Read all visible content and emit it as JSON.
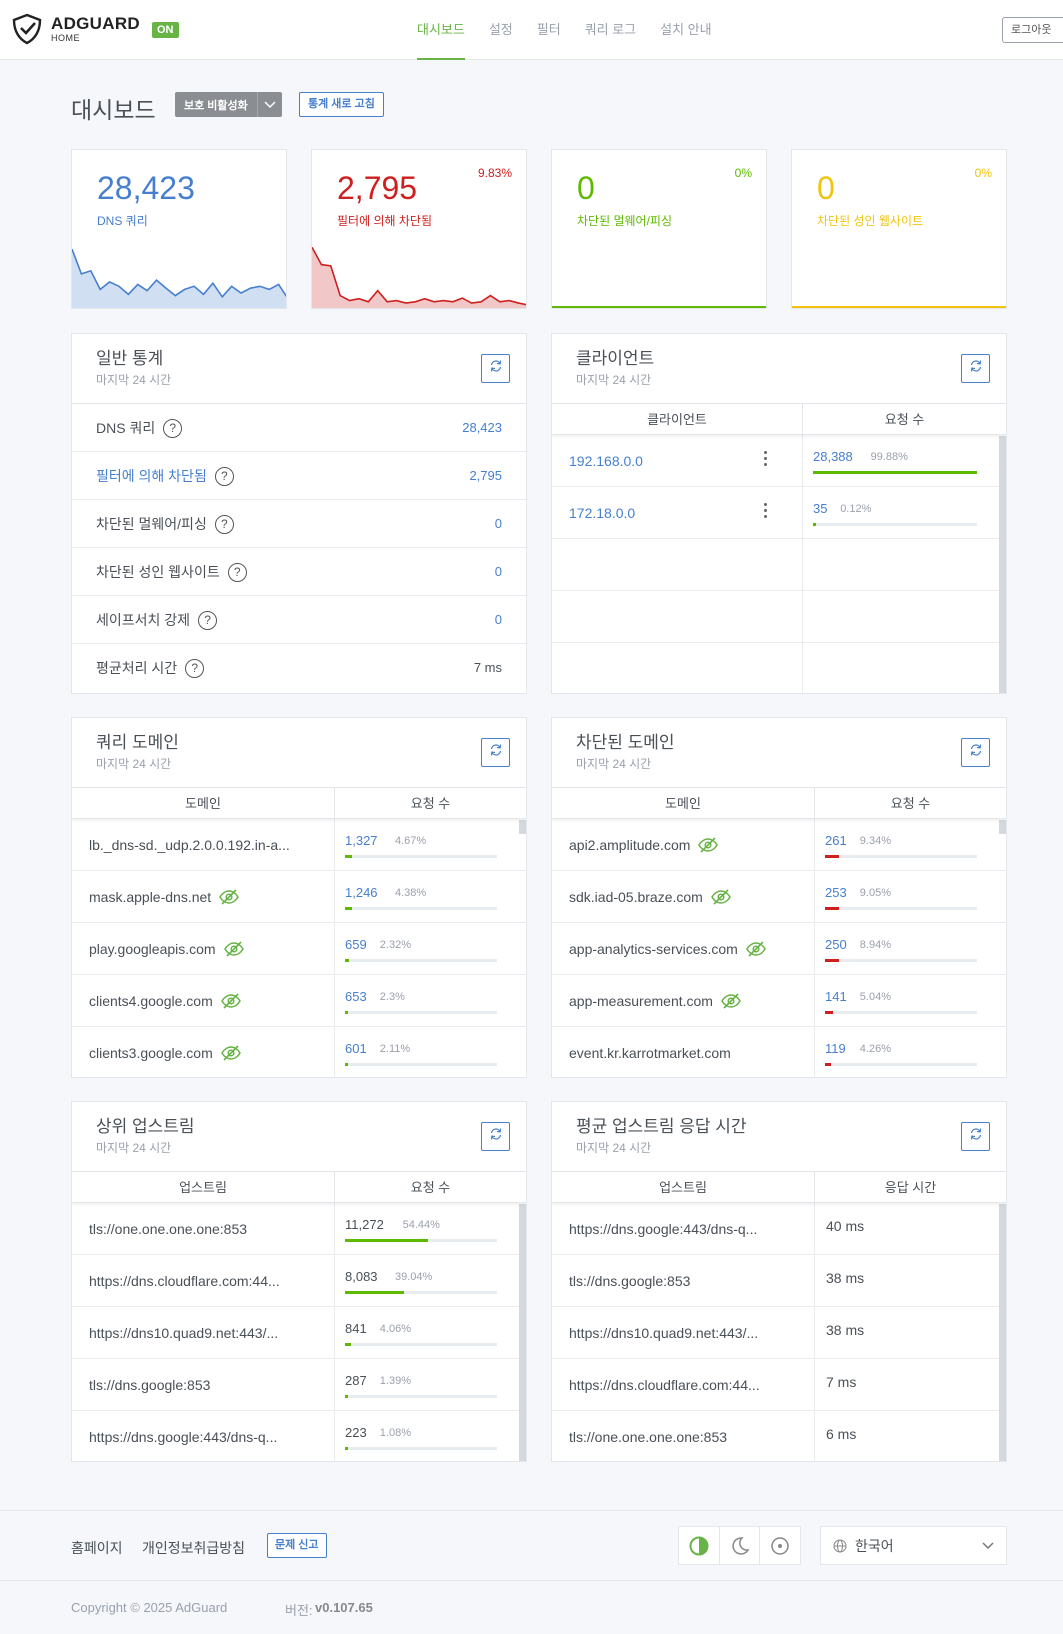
{
  "header": {
    "logo_title": "ADGUARD",
    "logo_sub": "HOME",
    "status_badge": "ON",
    "nav": [
      "대시보드",
      "설정",
      "필터",
      "쿼리 로그",
      "설치 안내"
    ],
    "logout": "로그아웃"
  },
  "page": {
    "title": "대시보드",
    "disable_protection": "보호 비활성화",
    "refresh_stats": "통계 새로 고침"
  },
  "stats": [
    {
      "value": "28,423",
      "label": "DNS 쿼리",
      "percent": "",
      "color": "#467fcf",
      "spark": [
        0.95,
        0.55,
        0.6,
        0.3,
        0.42,
        0.35,
        0.22,
        0.38,
        0.28,
        0.45,
        0.32,
        0.2,
        0.3,
        0.35,
        0.22,
        0.4,
        0.18,
        0.35,
        0.24,
        0.32,
        0.35,
        0.3,
        0.38,
        0.15
      ]
    },
    {
      "value": "2,795",
      "label": "필터에 의해 차단됨",
      "percent": "9.83%",
      "color": "#cd201f",
      "spark": [
        0.98,
        0.7,
        0.68,
        0.2,
        0.12,
        0.15,
        0.1,
        0.28,
        0.1,
        0.12,
        0.08,
        0.1,
        0.15,
        0.1,
        0.12,
        0.1,
        0.16,
        0.08,
        0.1,
        0.2,
        0.1,
        0.12,
        0.08,
        0.05
      ]
    },
    {
      "value": "0",
      "label": "차단된 멀웨어/피싱",
      "percent": "0%",
      "color": "#5eba00",
      "spark": []
    },
    {
      "value": "0",
      "label": "차단된 성인 웹사이트",
      "percent": "0%",
      "color": "#f1c40f",
      "spark": []
    }
  ],
  "general": {
    "title": "일반 통계",
    "subtitle": "마지막 24 시간",
    "rows": [
      {
        "label": "DNS 쿼리",
        "value": "28,423",
        "link": false,
        "vlink": true
      },
      {
        "label": "필터에 의해 차단됨",
        "value": "2,795",
        "link": true,
        "vlink": true
      },
      {
        "label": "차단된 멀웨어/피싱",
        "value": "0",
        "link": false,
        "vlink": true
      },
      {
        "label": "차단된 성인 웹사이트",
        "value": "0",
        "link": false,
        "vlink": true
      },
      {
        "label": "세이프서치 강제",
        "value": "0",
        "link": false,
        "vlink": true
      },
      {
        "label": "평균처리 시간",
        "value": "7 ms",
        "link": false,
        "vlink": false
      }
    ]
  },
  "clients": {
    "title": "클라이언트",
    "subtitle": "마지막 24 시간",
    "col1": "클라이언트",
    "col2": "요청 수",
    "rows": [
      {
        "name": "192.168.0.0",
        "count": "28,388",
        "pct": "99.88%",
        "frac": 0.9988
      },
      {
        "name": "172.18.0.0",
        "count": "35",
        "pct": "0.12%",
        "frac": 0.0012
      }
    ]
  },
  "query_domains": {
    "title": "쿼리 도메인",
    "subtitle": "마지막 24 시간",
    "col1": "도메인",
    "col2": "요청 수",
    "rows": [
      {
        "name": "lb._dns-sd._udp.2.0.0.192.in-a...",
        "count": "1,327",
        "pct": "4.67%",
        "frac": 0.0467,
        "eye": false
      },
      {
        "name": "mask.apple-dns.net",
        "count": "1,246",
        "pct": "4.38%",
        "frac": 0.0438,
        "eye": true
      },
      {
        "name": "play.googleapis.com",
        "count": "659",
        "pct": "2.32%",
        "frac": 0.0232,
        "eye": true
      },
      {
        "name": "clients4.google.com",
        "count": "653",
        "pct": "2.3%",
        "frac": 0.023,
        "eye": true
      },
      {
        "name": "clients3.google.com",
        "count": "601",
        "pct": "2.11%",
        "frac": 0.0211,
        "eye": true
      }
    ]
  },
  "blocked_domains": {
    "title": "차단된 도메인",
    "subtitle": "마지막 24 시간",
    "col1": "도메인",
    "col2": "요청 수",
    "rows": [
      {
        "name": "api2.amplitude.com",
        "count": "261",
        "pct": "9.34%",
        "frac": 0.0934,
        "eye": true
      },
      {
        "name": "sdk.iad-05.braze.com",
        "count": "253",
        "pct": "9.05%",
        "frac": 0.0905,
        "eye": true
      },
      {
        "name": "app-analytics-services.com",
        "count": "250",
        "pct": "8.94%",
        "frac": 0.0894,
        "eye": true
      },
      {
        "name": "app-measurement.com",
        "count": "141",
        "pct": "5.04%",
        "frac": 0.0504,
        "eye": true
      },
      {
        "name": "event.kr.karrotmarket.com",
        "count": "119",
        "pct": "4.26%",
        "frac": 0.0426,
        "eye": false
      }
    ]
  },
  "upstreams": {
    "title": "상위 업스트림",
    "subtitle": "마지막 24 시간",
    "col1": "업스트림",
    "col2": "요청 수",
    "rows": [
      {
        "name": "tls://one.one.one.one:853",
        "count": "11,272",
        "pct": "54.44%",
        "frac": 0.5444
      },
      {
        "name": "https://dns.cloudflare.com:44...",
        "count": "8,083",
        "pct": "39.04%",
        "frac": 0.3904
      },
      {
        "name": "https://dns10.quad9.net:443/...",
        "count": "841",
        "pct": "4.06%",
        "frac": 0.0406
      },
      {
        "name": "tls://dns.google:853",
        "count": "287",
        "pct": "1.39%",
        "frac": 0.0139
      },
      {
        "name": "https://dns.google:443/dns-q...",
        "count": "223",
        "pct": "1.08%",
        "frac": 0.0108
      }
    ]
  },
  "avg_upstream": {
    "title": "평균 업스트림 응답 시간",
    "subtitle": "마지막 24 시간",
    "col1": "업스트림",
    "col2": "응답 시간",
    "rows": [
      {
        "name": "https://dns.google:443/dns-q...",
        "time": "40 ms"
      },
      {
        "name": "tls://dns.google:853",
        "time": "38 ms"
      },
      {
        "name": "https://dns10.quad9.net:443/...",
        "time": "38 ms"
      },
      {
        "name": "https://dns.cloudflare.com:44...",
        "time": "7 ms"
      },
      {
        "name": "tls://one.one.one.one:853",
        "time": "6 ms"
      }
    ]
  },
  "footer": {
    "homepage": "홈페이지",
    "privacy": "개인정보취급방침",
    "report": "문제 신고",
    "language": "한국어",
    "copyright": "Copyright © 2025 AdGuard",
    "version_label": "버전:",
    "version": "v0.107.65"
  },
  "colors": {
    "primary": "#467fcf",
    "green": "#67b346",
    "red": "#cd201f",
    "yellow": "#f1c40f"
  }
}
